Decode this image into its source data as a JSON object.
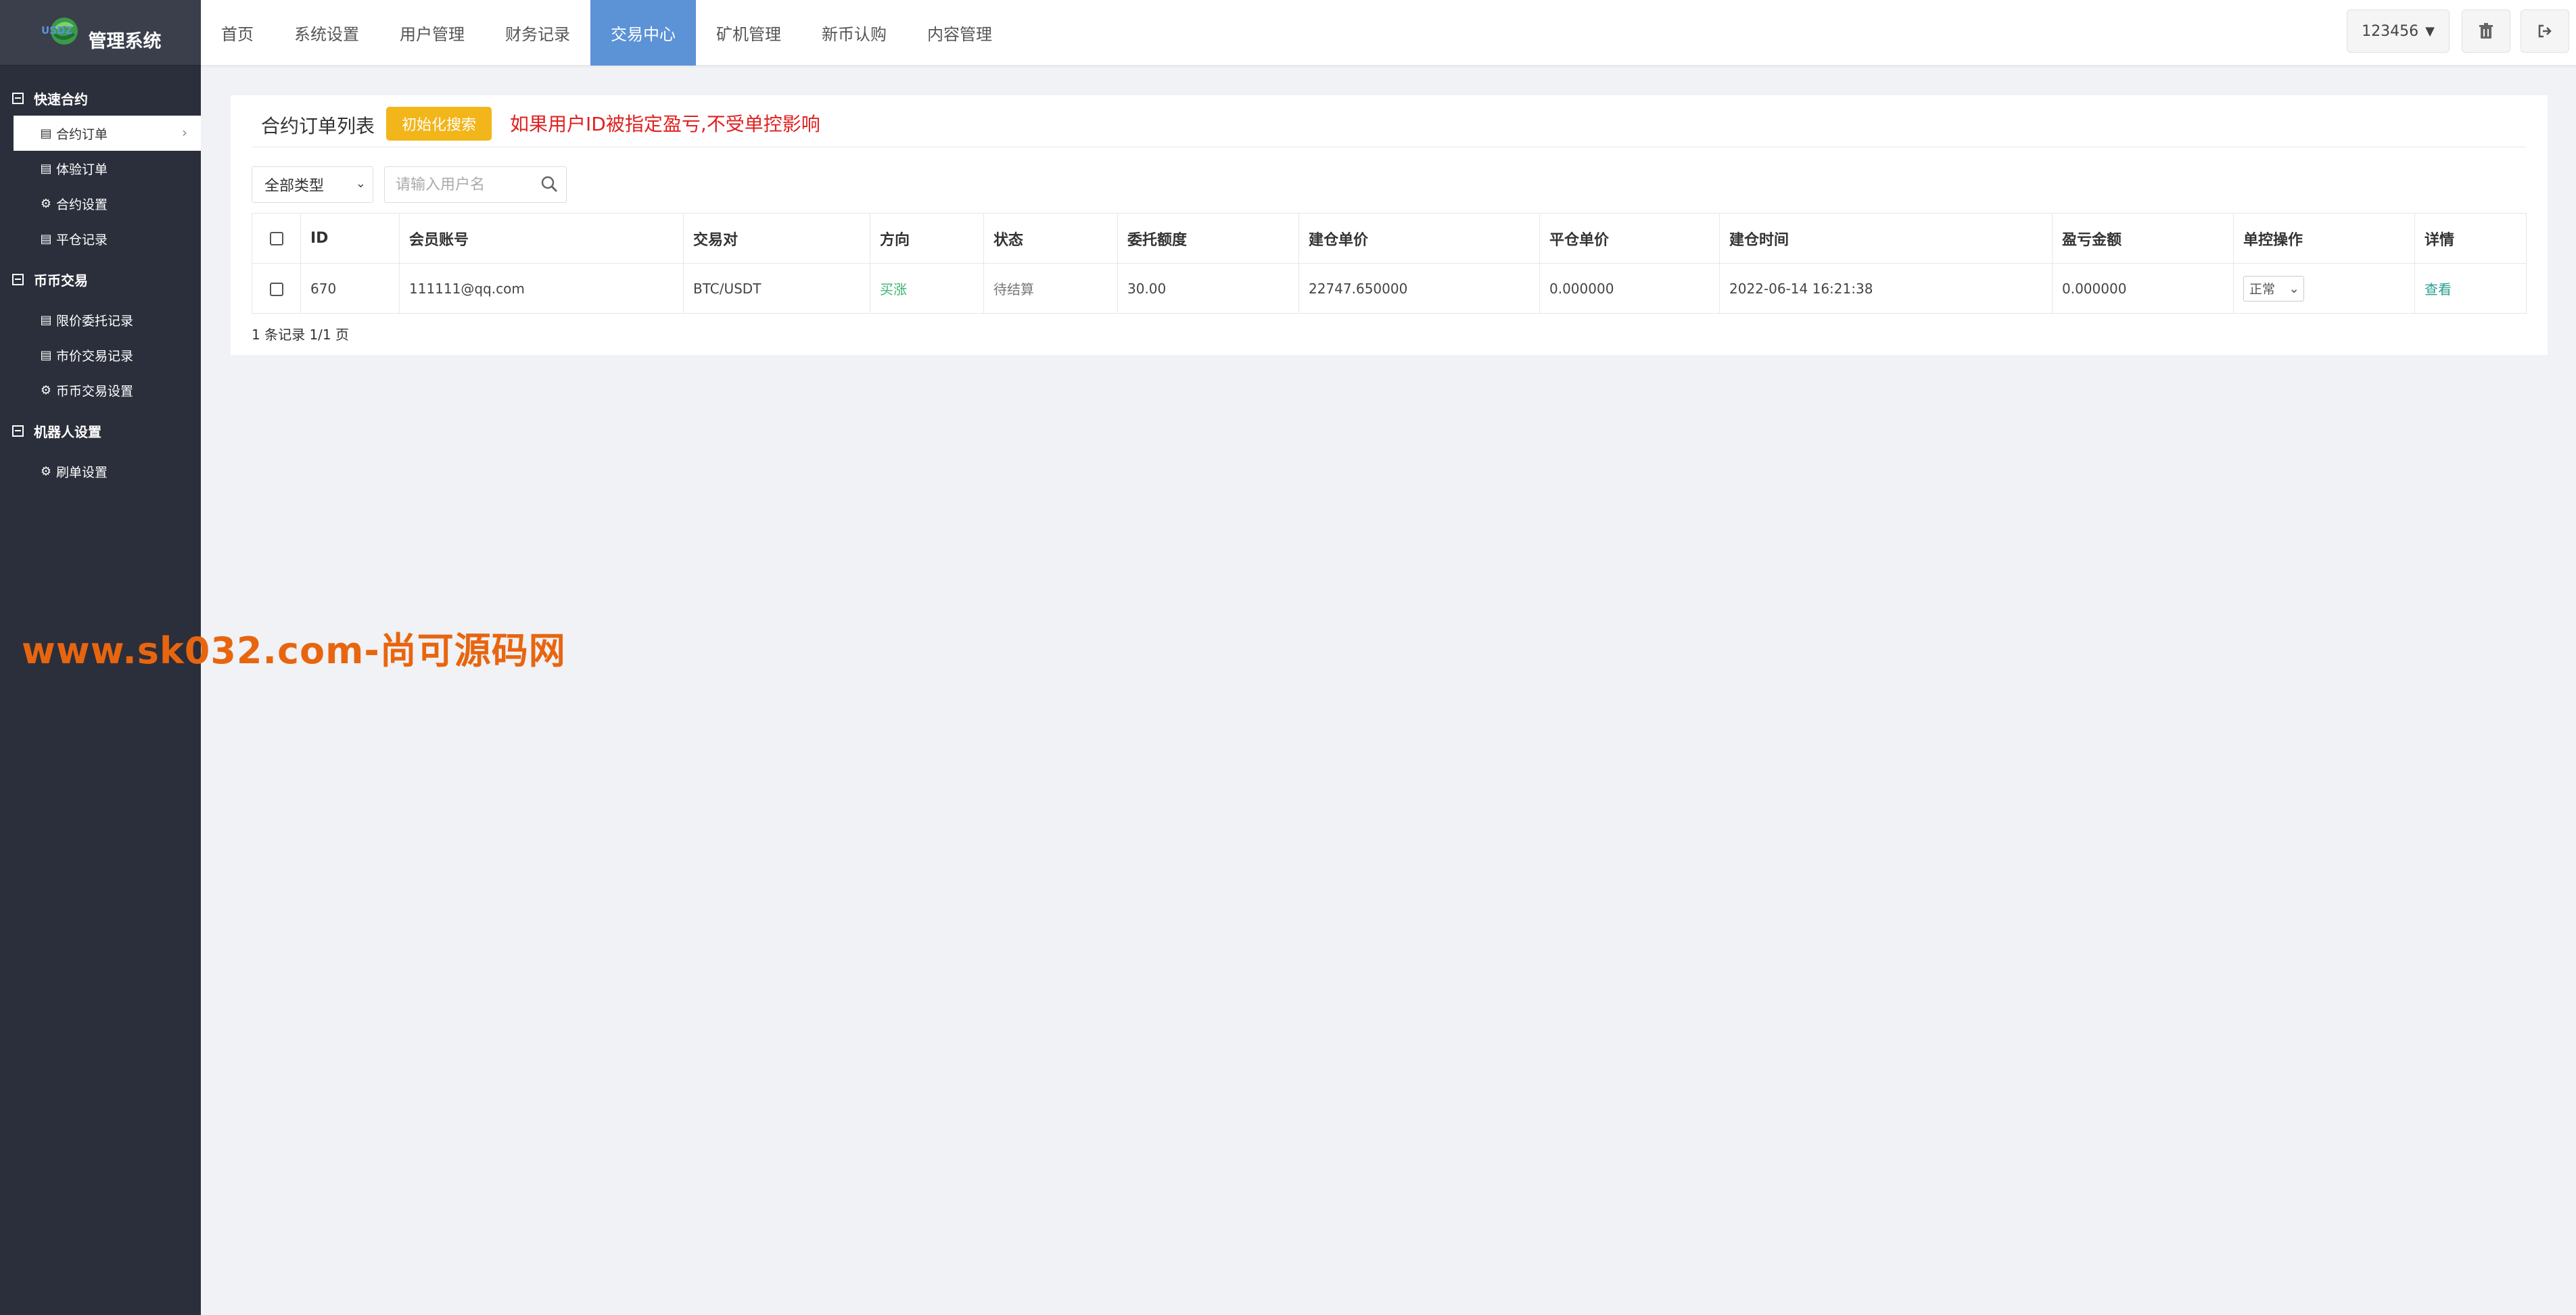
{
  "app": {
    "logo_text": "USDZ",
    "title": "管理系统"
  },
  "sidebar": {
    "groups": [
      {
        "label": "快速合约",
        "items": [
          {
            "label": "合约订单",
            "icon": "table-icon"
          },
          {
            "label": "体验订单",
            "icon": "table-icon"
          },
          {
            "label": "合约设置",
            "icon": "gear-icon"
          },
          {
            "label": "平仓记录",
            "icon": "table-icon"
          }
        ]
      },
      {
        "label": "币币交易",
        "items": [
          {
            "label": "限价委托记录",
            "icon": "table-icon"
          },
          {
            "label": "市价交易记录",
            "icon": "table-icon"
          },
          {
            "label": "币币交易设置",
            "icon": "gear-icon"
          }
        ]
      },
      {
        "label": "机器人设置",
        "items": [
          {
            "label": "刷单设置",
            "icon": "gear-icon"
          }
        ]
      }
    ]
  },
  "watermark": "www.sk032.com-尚可源码网",
  "topnav": {
    "items": [
      "首页",
      "系统设置",
      "用户管理",
      "财务记录",
      "交易中心",
      "矿机管理",
      "新币认购",
      "内容管理"
    ],
    "active": "交易中心",
    "user_label": "123456",
    "active_color": "#5b93d6"
  },
  "panel": {
    "title": "合约订单列表",
    "reset_button": "初始化搜索",
    "warning": "如果用户ID被指定盈亏,不受单控影响"
  },
  "filters": {
    "type_select": "全部类型",
    "search_placeholder": "请输入用户名"
  },
  "table": {
    "headers": [
      "ID",
      "会员账号",
      "交易对",
      "方向",
      "状态",
      "委托额度",
      "建仓单价",
      "平仓单价",
      "建仓时间",
      "盈亏金额",
      "单控操作",
      "详情"
    ],
    "rows": [
      {
        "id": "670",
        "account": "111111@qq.com",
        "pair": "BTC/USDT",
        "direction": "买涨",
        "status": "待结算",
        "amount": "30.00",
        "open_price": "22747.650000",
        "close_price": "0.000000",
        "open_time": "2022-06-14 16:21:38",
        "pnl": "0.000000",
        "control": "正常",
        "detail": "查看"
      }
    ]
  },
  "pagination": "1 条记录 1/1 页"
}
